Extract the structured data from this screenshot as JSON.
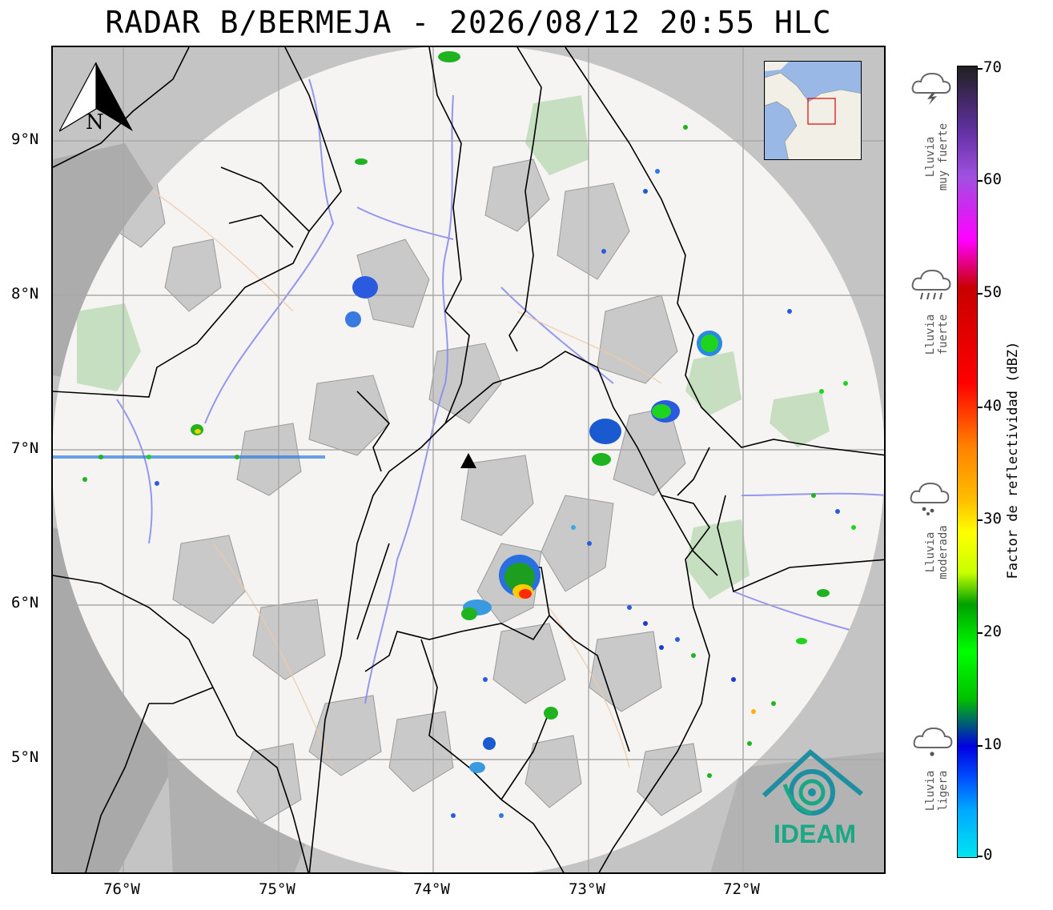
{
  "title": "RADAR B/BERMEJA - 2026/08/12 20:55 HLC",
  "axes": {
    "y_labels": [
      "9°N",
      "8°N",
      "7°N",
      "6°N",
      "5°N"
    ],
    "x_labels": [
      "76°W",
      "75°W",
      "74°W",
      "73°W",
      "72°W"
    ]
  },
  "colorbar": {
    "title": "Factor de reflectividad (dBZ)",
    "ticks": [
      "70",
      "60",
      "50",
      "40",
      "30",
      "20",
      "10",
      "0"
    ]
  },
  "categories": [
    {
      "label_line1": "Lluvia",
      "label_line2": "muy fuerte",
      "icon": "thunderstorm-cloud-icon"
    },
    {
      "label_line1": "Lluvia",
      "label_line2": "fuerte",
      "icon": "heavy-rain-cloud-icon"
    },
    {
      "label_line1": "Lluvia",
      "label_line2": "moderada",
      "icon": "moderate-rain-cloud-icon"
    },
    {
      "label_line1": "Lluvia",
      "label_line2": "ligera",
      "icon": "light-rain-cloud-icon"
    }
  ],
  "compass": {
    "letter": "N"
  },
  "logo": {
    "text": "IDEAM",
    "color": "#1aa884"
  },
  "colors": {
    "radar_disk": "#f5f4f2",
    "outside": "#c7c7c7",
    "grid": "#a8a8a8",
    "rivers": "#8a8cf0"
  }
}
